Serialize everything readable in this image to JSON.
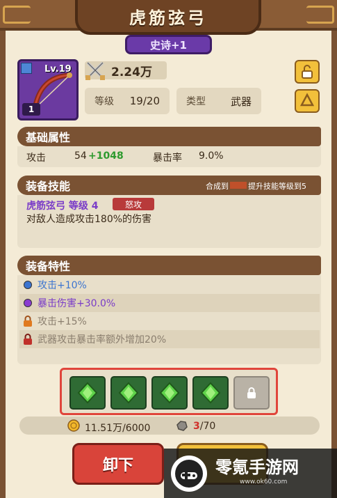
{
  "title": "虎筋弦弓",
  "rarity": "史诗+1",
  "item": {
    "level": "Lv.19",
    "count": "1"
  },
  "power": "2.24万",
  "stats": [
    {
      "label": "等级",
      "value": "19/20"
    },
    {
      "label": "类型",
      "value": "武器"
    }
  ],
  "base_attrs": {
    "header": "基础属性",
    "attack_label": "攻击",
    "attack_base": "54",
    "attack_bonus": "+1048",
    "crit_label": "暴击率",
    "crit_value": "9.0%"
  },
  "skill": {
    "header": "装备技能",
    "hint_prefix": "合成到",
    "hint_suffix": "提升技能等级到5",
    "name": "虎筋弦弓 等级 4",
    "tag": "怒攻",
    "desc": "对敌人造成攻击180%的伤害"
  },
  "traits": {
    "header": "装备特性",
    "items": [
      {
        "text": "攻击+10%",
        "state": "active-blue"
      },
      {
        "text": "暴击伤害+30.0%",
        "state": "active-purple"
      },
      {
        "text": "攻击+15%",
        "state": "locked-orange"
      },
      {
        "text": "武器攻击暴击率额外增加20%",
        "state": "locked-red"
      }
    ]
  },
  "gems": {
    "filled": 4,
    "locked": 1
  },
  "cost": {
    "gold": "11.51万/6000",
    "stone_current": "3",
    "stone_total": "/70"
  },
  "buttons": {
    "unequip": "卸下"
  },
  "watermark": {
    "text": "零氪手游网",
    "url": "www.ok60.com"
  },
  "colors": {
    "accent_brown": "#7a5233",
    "epic_purple": "#6a3aa8",
    "button_red": "#d9443a",
    "button_yellow": "#f2c03b",
    "gem_highlight": "#e0453b"
  }
}
